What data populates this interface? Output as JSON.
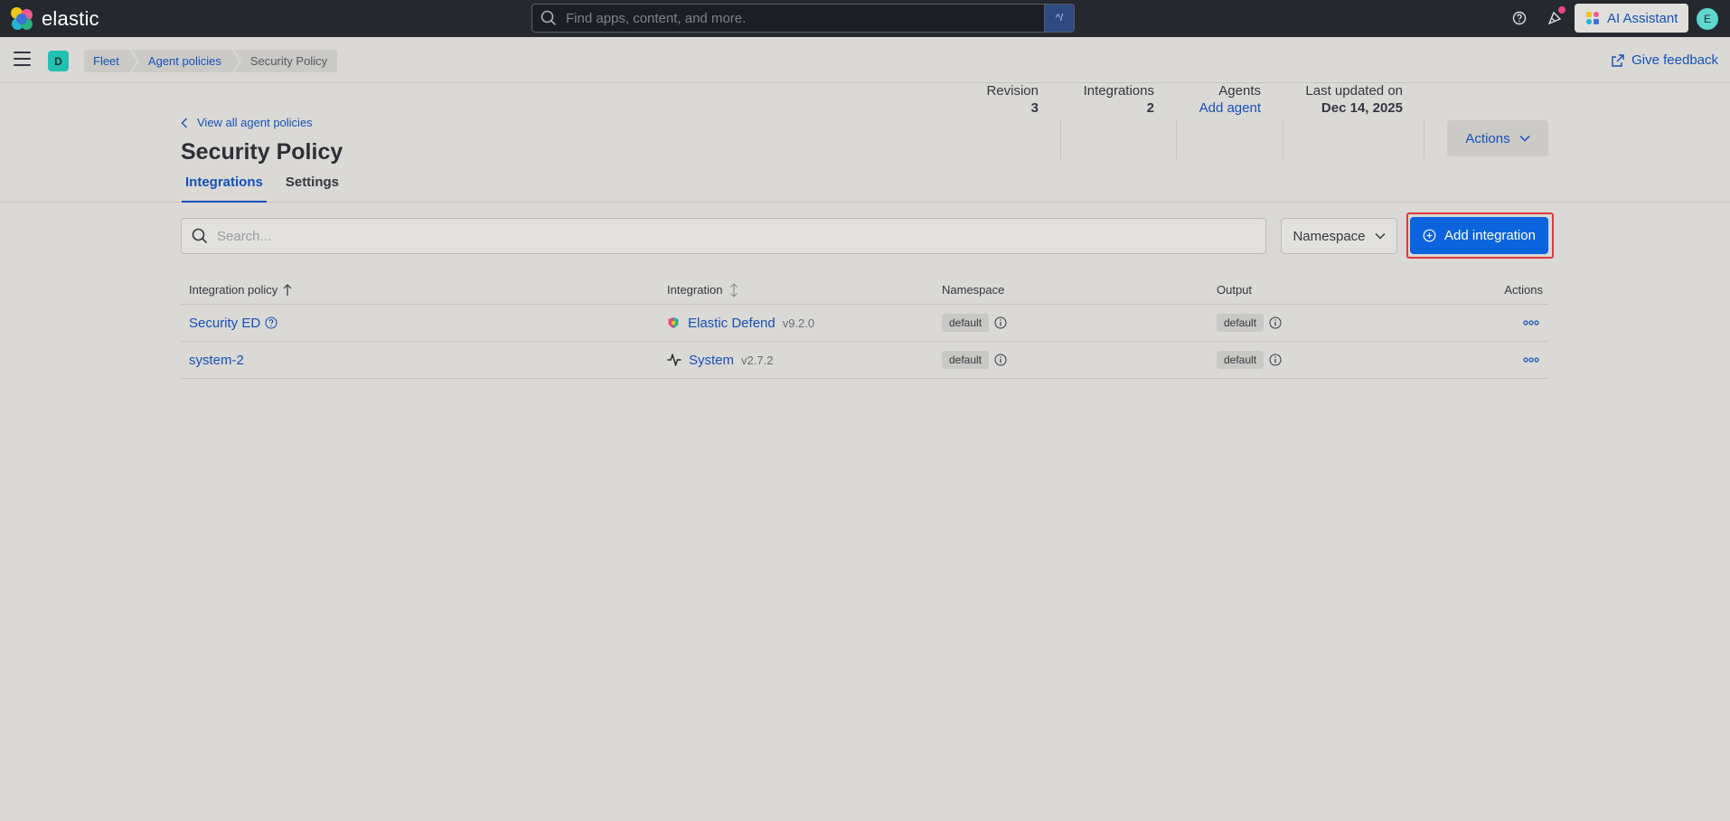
{
  "header": {
    "brand": "elastic",
    "search_placeholder": "Find apps, content, and more.",
    "search_shortcut": "^/",
    "ai_assistant_label": "AI Assistant",
    "user_initial": "E"
  },
  "subheader": {
    "space_initial": "D",
    "breadcrumbs": [
      "Fleet",
      "Agent policies",
      "Security Policy"
    ],
    "feedback_label": "Give feedback"
  },
  "page": {
    "back_link": "View all agent policies",
    "title": "Security Policy",
    "tabs": [
      {
        "label": "Integrations",
        "active": true
      },
      {
        "label": "Settings",
        "active": false
      }
    ],
    "stats": {
      "revision_label": "Revision",
      "revision_value": "3",
      "integrations_label": "Integrations",
      "integrations_value": "2",
      "agents_label": "Agents",
      "agents_link": "Add agent",
      "updated_label": "Last updated on",
      "updated_value": "Dec 14, 2025"
    },
    "actions_label": "Actions"
  },
  "toolbar": {
    "search_placeholder": "Search...",
    "namespace_label": "Namespace",
    "add_integration_label": "Add integration"
  },
  "table": {
    "columns": [
      "Integration policy",
      "Integration",
      "Namespace",
      "Output",
      "Actions"
    ],
    "rows": [
      {
        "policy": "Security ED",
        "integration": "Elastic Defend",
        "version": "v9.2.0",
        "namespace": "default",
        "output": "default"
      },
      {
        "policy": "system-2",
        "integration": "System",
        "version": "v2.7.2",
        "namespace": "default",
        "output": "default"
      }
    ]
  },
  "colors": {
    "accent": "#1650b8",
    "primary_button": "#0b64dd",
    "highlight_frame": "#e0383e",
    "topbar": "#25282f"
  }
}
